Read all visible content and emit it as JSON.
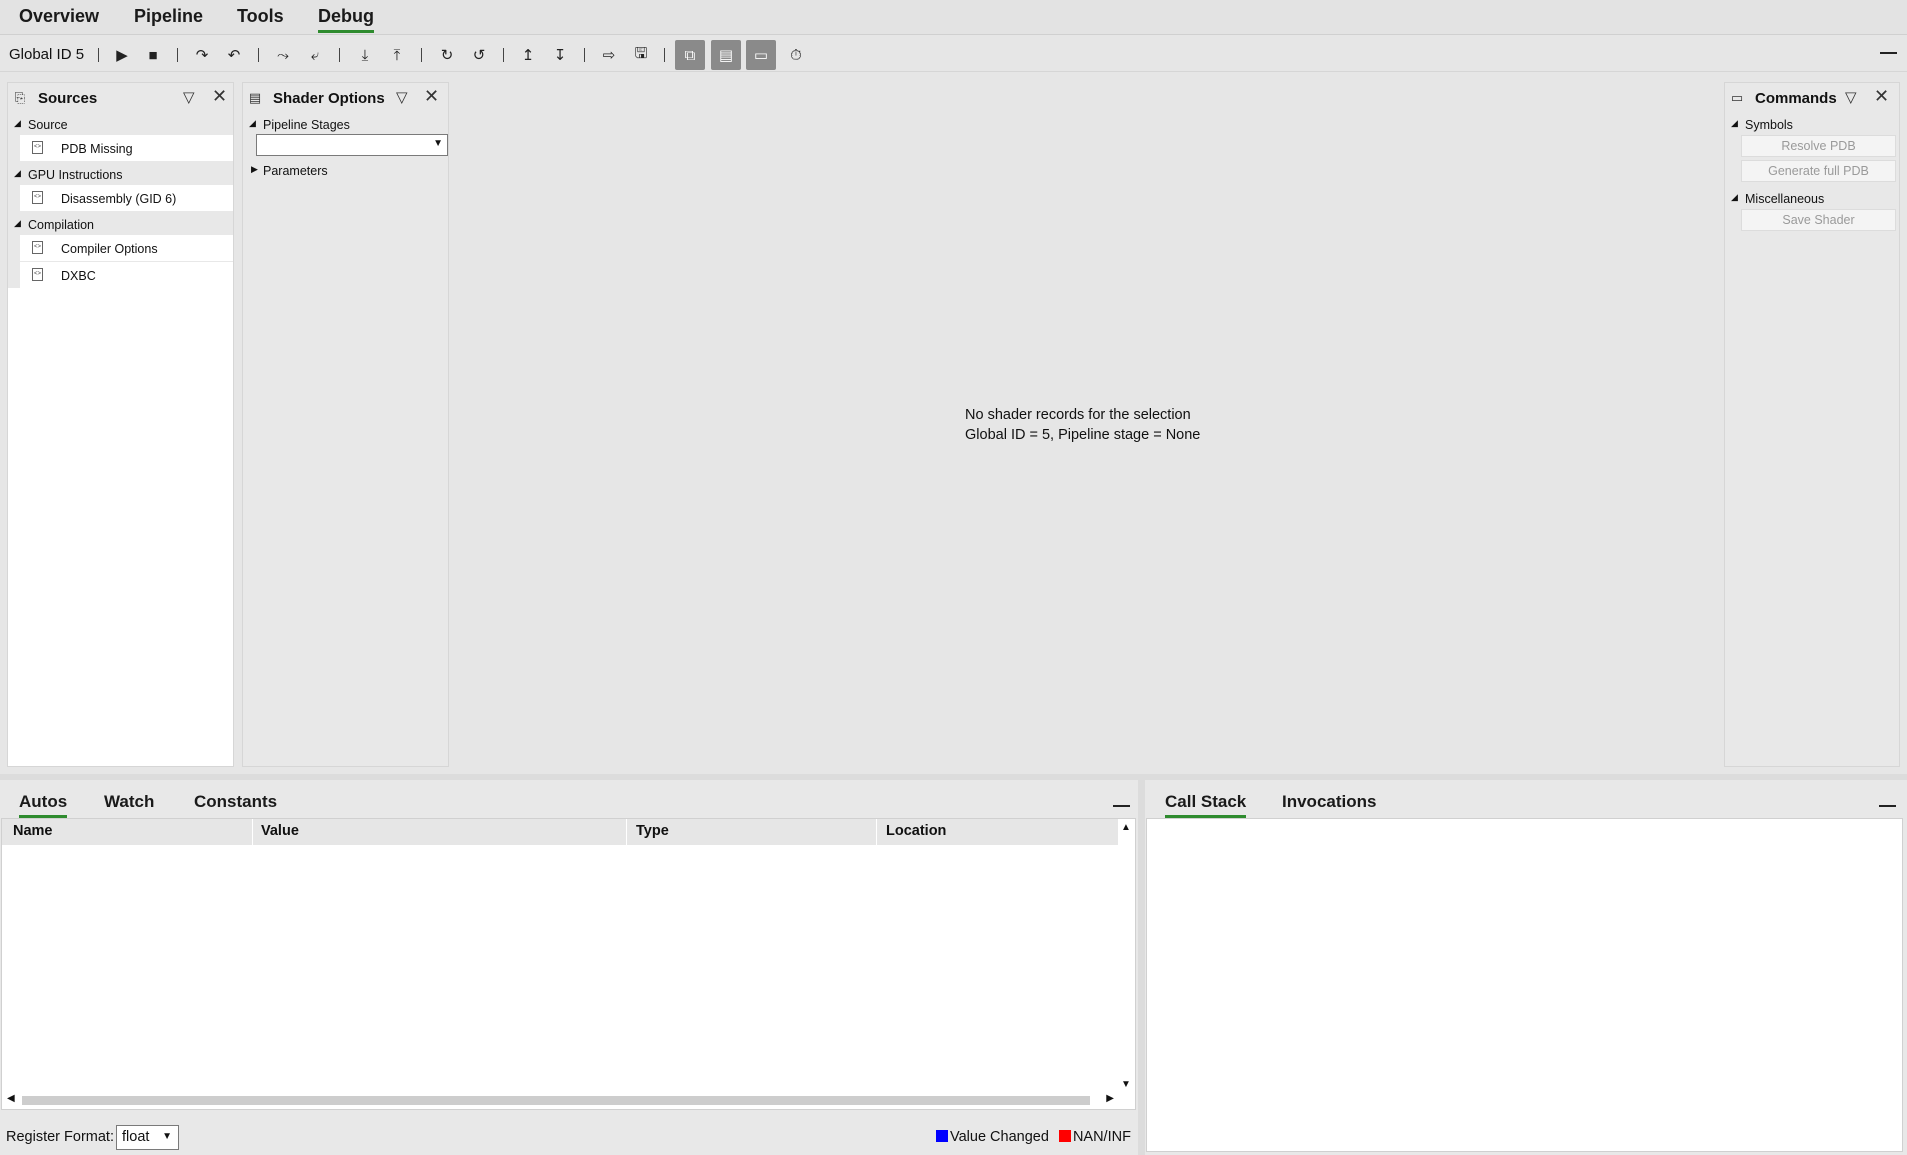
{
  "top_tabs": [
    {
      "label": "Overview"
    },
    {
      "label": "Pipeline"
    },
    {
      "label": "Tools"
    },
    {
      "label": "Debug",
      "active": true
    }
  ],
  "toolbar": {
    "label": "Global ID 5",
    "buttons": [
      "play-icon",
      "stop-icon",
      "step-over-icon",
      "step-back-icon",
      "step-over-group-icon",
      "step-back-group-icon",
      "step-into-icon",
      "step-out-icon",
      "loop-forward-icon",
      "loop-back-icon",
      "step-up-icon",
      "step-down-icon",
      "goto-icon",
      "save-icon",
      "source-view-icon",
      "shader-options-icon",
      "commands-view-icon",
      "timer-icon"
    ]
  },
  "sources_panel": {
    "title": "Sources",
    "groups": [
      {
        "label": "Source",
        "items": [
          "PDB Missing"
        ]
      },
      {
        "label": "GPU Instructions",
        "items": [
          "Disassembly (GID 6)"
        ]
      },
      {
        "label": "Compilation",
        "items": [
          "Compiler Options",
          "DXBC"
        ]
      }
    ]
  },
  "shader_options_panel": {
    "title": "Shader Options",
    "pipeline_stages_label": "Pipeline Stages",
    "pipeline_stages_value": "",
    "parameters_label": "Parameters"
  },
  "center": {
    "message_line1": "No shader records for the selection",
    "message_line2": "Global ID = 5, Pipeline stage = None"
  },
  "commands_panel": {
    "title": "Commands",
    "symbols_label": "Symbols",
    "resolve_pdb": "Resolve PDB",
    "generate_full_pdb": "Generate full PDB",
    "misc_label": "Miscellaneous",
    "save_shader": "Save Shader"
  },
  "bottom_left": {
    "tabs": [
      {
        "label": "Autos",
        "active": true
      },
      {
        "label": "Watch"
      },
      {
        "label": "Constants"
      }
    ],
    "columns": [
      "Name",
      "Value",
      "Type",
      "Location"
    ],
    "register_format_label": "Register Format:",
    "register_format_value": "float",
    "legend_value_changed": "Value Changed",
    "legend_nan_inf": "NAN/INF",
    "colors": {
      "value_changed": "#0000ff",
      "nan_inf": "#ff0000"
    }
  },
  "bottom_right": {
    "tabs": [
      {
        "label": "Call Stack",
        "active": true
      },
      {
        "label": "Invocations"
      }
    ]
  }
}
